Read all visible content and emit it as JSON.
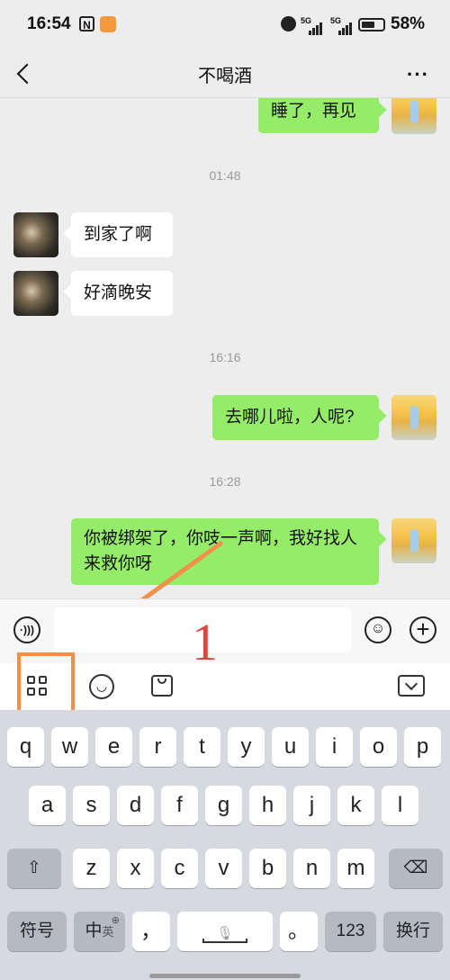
{
  "status_bar": {
    "time": "16:54",
    "nfc_glyph": "N",
    "signal1": "5G",
    "signal2": "5G",
    "battery_percent": "58%"
  },
  "header": {
    "title": "不喝酒",
    "more_glyph": "···"
  },
  "chat": {
    "messages": [
      {
        "type": "out",
        "text": "睡了，再见"
      },
      {
        "type": "time",
        "text": "01:48"
      },
      {
        "type": "in",
        "text": "到家了啊"
      },
      {
        "type": "in",
        "text": "好滴晚安"
      },
      {
        "type": "time",
        "text": "16:16"
      },
      {
        "type": "out",
        "text": "去哪儿啦，人呢?"
      },
      {
        "type": "time",
        "text": "16:28"
      },
      {
        "type": "out",
        "text": "你被绑架了，你吱一声啊，我好找人来救你呀"
      }
    ]
  },
  "input_bar": {
    "voice_glyph": "·)))",
    "placeholder": "",
    "emoji_glyph": "☺",
    "plus_glyph": "+"
  },
  "toolbar": {
    "icons": [
      "apps-grid-icon",
      "emoji-icon",
      "bag-icon",
      "collapse-keyboard-icon"
    ],
    "smile_glyph": "◡"
  },
  "keyboard": {
    "row1": [
      "q",
      "w",
      "e",
      "r",
      "t",
      "y",
      "u",
      "i",
      "o",
      "p"
    ],
    "row2": [
      "a",
      "s",
      "d",
      "f",
      "g",
      "h",
      "j",
      "k",
      "l"
    ],
    "row3": [
      "z",
      "x",
      "c",
      "v",
      "b",
      "n",
      "m"
    ],
    "shift_glyph": "⇧",
    "delete_glyph": "⌫",
    "symbols": "符号",
    "lang_main": "中",
    "lang_sub": "英",
    "comma": "，",
    "mic_glyph": "🎙",
    "period": "。",
    "num": "123",
    "enter": "换行"
  },
  "annotation": {
    "number": "1",
    "color": "#f2904a"
  },
  "colors": {
    "outgoing_bubble": "#95ec69",
    "incoming_bubble": "#ffffff",
    "background": "#ededed"
  }
}
